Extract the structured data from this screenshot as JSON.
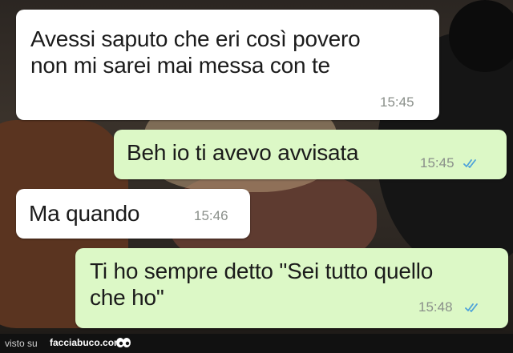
{
  "messages": [
    {
      "direction": "incoming",
      "text": "Avessi saputo che eri così povero\nnon mi sarei mai messa con te",
      "time": "15:45"
    },
    {
      "direction": "outgoing",
      "text": "Beh io ti avevo avvisata",
      "time": "15:45",
      "status": "read"
    },
    {
      "direction": "incoming",
      "text": "Ma quando",
      "time": "15:46"
    },
    {
      "direction": "outgoing",
      "text": "Ti ho sempre detto \"Sei tutto quello\nche ho\"",
      "time": "15:48",
      "status": "read"
    }
  ],
  "footer": {
    "prefix": "visto su",
    "site": "facciabuco.com",
    "logo_icon": "facciabuco-eyes-logo"
  },
  "colors": {
    "incoming_bubble": "#ffffff",
    "outgoing_bubble": "#dcf8c6",
    "read_ticks": "#4fa3d9",
    "timestamp": "#8a8f8a"
  }
}
